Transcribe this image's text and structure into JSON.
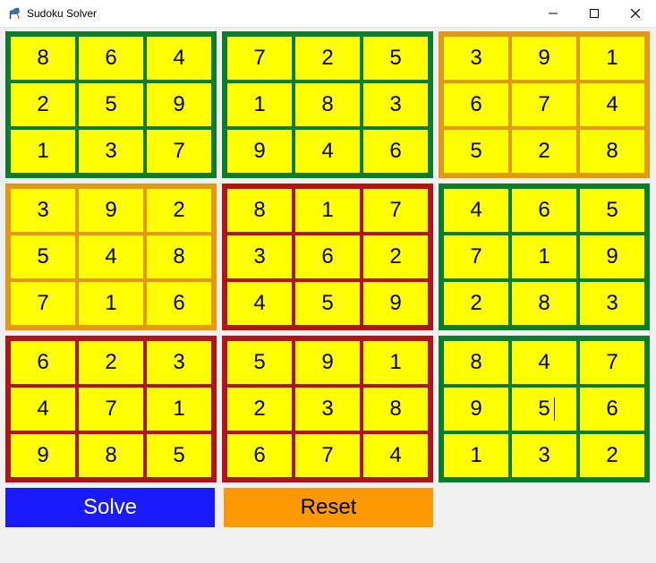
{
  "window": {
    "title": "Sudoku Solver",
    "controls": {
      "minimize": "min",
      "maximize": "max",
      "close": "close"
    }
  },
  "sudoku": {
    "subgrids": [
      {
        "color": "green",
        "cells": [
          "8",
          "6",
          "4",
          "2",
          "5",
          "9",
          "1",
          "3",
          "7"
        ]
      },
      {
        "color": "green",
        "cells": [
          "7",
          "2",
          "5",
          "1",
          "8",
          "3",
          "9",
          "4",
          "6"
        ]
      },
      {
        "color": "orange",
        "cells": [
          "3",
          "9",
          "1",
          "6",
          "7",
          "4",
          "5",
          "2",
          "8"
        ]
      },
      {
        "color": "orange",
        "cells": [
          "3",
          "9",
          "2",
          "5",
          "4",
          "8",
          "7",
          "1",
          "6"
        ]
      },
      {
        "color": "red",
        "cells": [
          "8",
          "1",
          "7",
          "3",
          "6",
          "2",
          "4",
          "5",
          "9"
        ]
      },
      {
        "color": "green",
        "cells": [
          "4",
          "6",
          "5",
          "7",
          "1",
          "9",
          "2",
          "8",
          "3"
        ]
      },
      {
        "color": "red",
        "cells": [
          "6",
          "2",
          "3",
          "4",
          "7",
          "1",
          "9",
          "8",
          "5"
        ]
      },
      {
        "color": "red",
        "cells": [
          "5",
          "9",
          "1",
          "2",
          "3",
          "8",
          "6",
          "7",
          "4"
        ]
      },
      {
        "color": "green",
        "cells": [
          "8",
          "4",
          "7",
          "9",
          "5",
          "6",
          "1",
          "3",
          "2"
        ]
      }
    ],
    "focused_cell": {
      "subgrid": 8,
      "cell": 4
    }
  },
  "buttons": {
    "solve": "Solve",
    "reset": "Reset"
  }
}
